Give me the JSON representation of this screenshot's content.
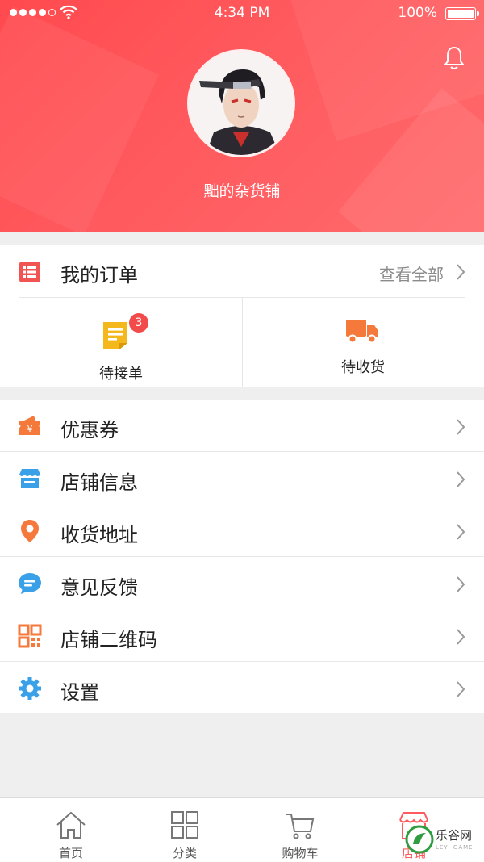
{
  "status_bar": {
    "time": "4:34 PM",
    "battery": "100%"
  },
  "header": {
    "shop_name": "黜的杂货铺"
  },
  "orders": {
    "title": "我的订单",
    "view_all": "查看全部",
    "items": [
      {
        "label": "待接单",
        "badge": "3",
        "icon": "order-doc-icon"
      },
      {
        "label": "待收货",
        "icon": "truck-icon"
      }
    ]
  },
  "menu": {
    "items": [
      {
        "label": "优惠券",
        "icon": "coupon-icon",
        "color": "#f4793b"
      },
      {
        "label": "店铺信息",
        "icon": "store-icon",
        "color": "#3aa0e8"
      },
      {
        "label": "收货地址",
        "icon": "location-pin-icon",
        "color": "#f4793b"
      },
      {
        "label": "意见反馈",
        "icon": "feedback-bubble-icon",
        "color": "#3aa0e8"
      },
      {
        "label": "店铺二维码",
        "icon": "qr-code-icon",
        "color": "#f4793b"
      },
      {
        "label": "设置",
        "icon": "gear-icon",
        "color": "#3aa0e8"
      }
    ]
  },
  "tabbar": {
    "items": [
      {
        "label": "首页",
        "icon": "home-icon"
      },
      {
        "label": "分类",
        "icon": "grid-icon"
      },
      {
        "label": "购物车",
        "icon": "cart-icon"
      },
      {
        "label": "店铺",
        "icon": "shop-icon",
        "active": true
      }
    ]
  },
  "watermark": {
    "text": "乐谷网",
    "sub": "LEYI GAME"
  },
  "colors": {
    "accent": "#ff5a5e",
    "orange": "#f4793b",
    "blue": "#3aa0e8",
    "badge": "#f14b4b"
  }
}
